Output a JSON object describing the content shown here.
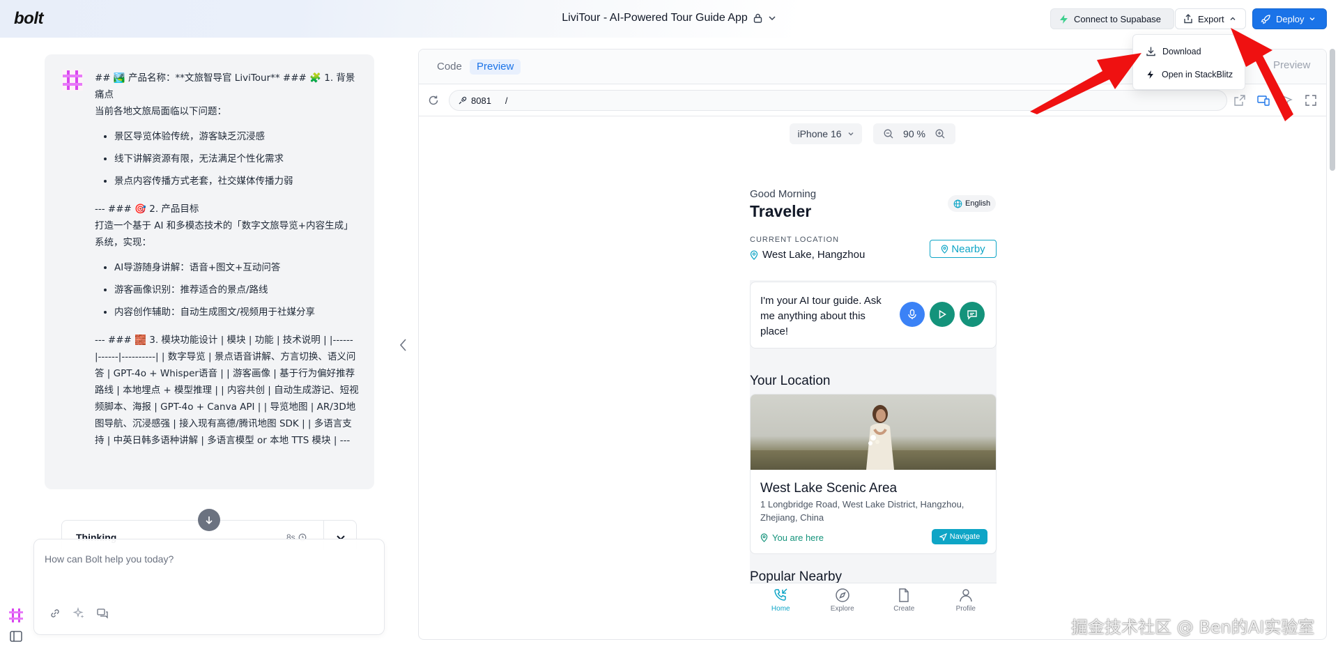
{
  "topbar": {
    "logo": "bolt",
    "project_title": "LiviTour - AI-Powered Tour Guide App",
    "connect_label": "Connect to Supabase",
    "export_label": "Export",
    "deploy_label": "Deploy"
  },
  "export_menu": {
    "items": [
      {
        "label": "Download",
        "icon": "download-icon"
      },
      {
        "label": "Open in StackBlitz",
        "icon": "lightning-icon"
      }
    ]
  },
  "chat": {
    "message": {
      "intro_line": "## 🏞️ 产品名称：**文旅智导官 LiviTour** ### 🧩 1. 背景痛点",
      "intro_sub": "当前各地文旅局面临以下问题：",
      "pain_points": [
        "景区导览体验传统，游客缺乏沉浸感",
        "线下讲解资源有限，无法满足个性化需求",
        "景点内容传播方式老套，社交媒体传播力弱"
      ],
      "goal_line": "--- ### 🎯 2. 产品目标",
      "goal_sub": "打造一个基于 AI 和多模态技术的「数字文旅导览+内容生成」系统，实现：",
      "goals": [
        "AI导游随身讲解：语音+图文+互动问答",
        "游客画像识别：推荐适合的景点/路线",
        "内容创作辅助：自动生成图文/视频用于社媒分享"
      ],
      "module_text": "--- ### 🧱 3. 模块功能设计 | 模块 | 功能 | 技术说明 | |------|------|----------| | 数字导览 | 景点语音讲解、方言切换、语义问答 | GPT-4o + Whisper语音 | | 游客画像 | 基于行为偏好推荐路线 | 本地埋点 + 模型推理 | | 内容共创 | 自动生成游记、短视频脚本、海报 | GPT-4o + Canva API | | 导览地图 | AR/3D地图导航、沉浸感强 | 接入现有高德/腾讯地图 SDK | | 多语言支持 | 中英日韩多语种讲解 | 多语言模型 or 本地 TTS 模块 | ---"
    },
    "thinking": {
      "label": "Thinking",
      "time": "8s"
    },
    "prompt": {
      "placeholder": "How can Bolt help you today?",
      "value": ""
    }
  },
  "preview": {
    "tabs": [
      {
        "label": "Code",
        "active": false
      },
      {
        "label": "Preview",
        "active": true
      }
    ],
    "tab_right_label": "Preview",
    "url": {
      "port": "8081",
      "path": "/"
    },
    "device": "iPhone 16",
    "zoom": "90 %"
  },
  "app": {
    "greeting": "Good Morning",
    "name": "Traveler",
    "language": "English",
    "location_caption": "CURRENT LOCATION",
    "location_name": "West Lake, Hangzhou",
    "nearby_label": "Nearby",
    "ai_text": "I'm your AI tour guide. Ask me anything about this place!",
    "your_location_title": "Your Location",
    "spot_name": "West Lake Scenic Area",
    "spot_address": "1 Longbridge Road, West Lake District, Hangzhou, Zhejiang, China",
    "here_label": "You are here",
    "navigate_label": "Navigate",
    "popular_title": "Popular Nearby",
    "nav": [
      {
        "label": "Home",
        "icon": "phone-icon",
        "active": true
      },
      {
        "label": "Explore",
        "icon": "compass-icon",
        "active": false
      },
      {
        "label": "Create",
        "icon": "document-icon",
        "active": false
      },
      {
        "label": "Profile",
        "icon": "user-icon",
        "active": false
      }
    ]
  },
  "watermark": "掘金技术社区 @ Ben的AI实验室",
  "colors": {
    "accent": "#1a73e8",
    "teal": "#0ea5c6",
    "green": "#14937b",
    "arrow_red": "#ef1111"
  }
}
